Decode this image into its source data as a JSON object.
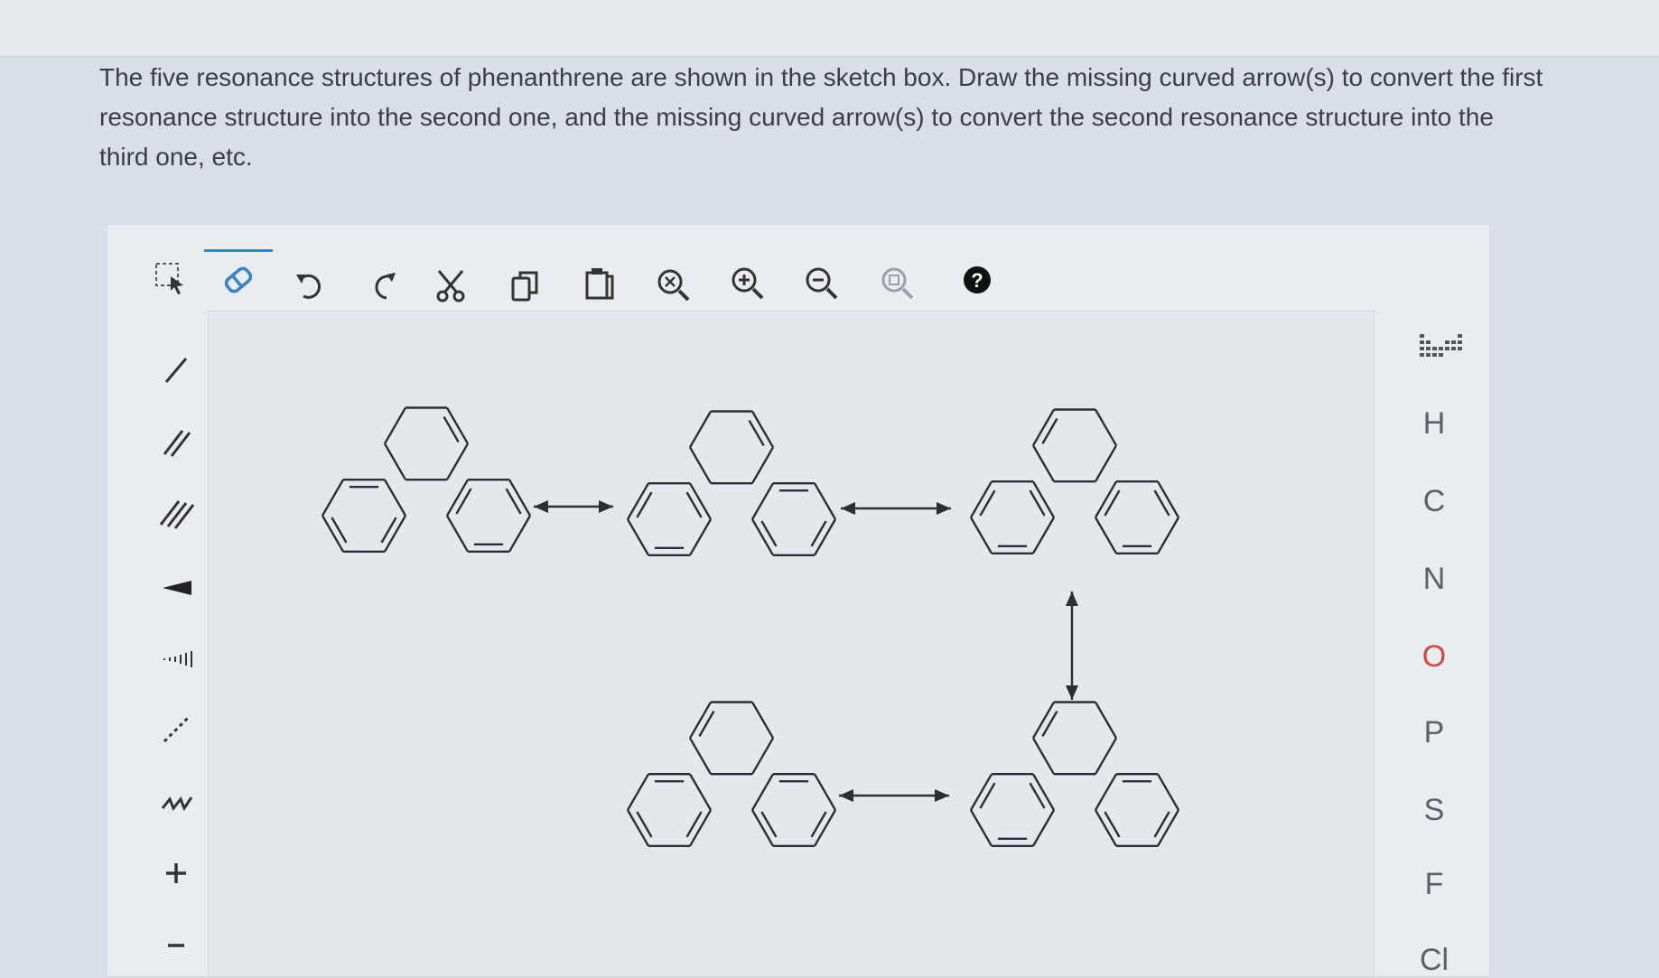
{
  "question": {
    "lines": [
      "The five resonance structures of phenanthrene are shown in the sketch box. Draw the missing curved arrow(s) to convert the first",
      "resonance structure into the second one, and the missing curved arrow(s) to convert the second resonance structure into the",
      "third one, etc."
    ]
  },
  "toolbar": {
    "tools": [
      "selection-tool",
      "eraser-tool",
      "undo",
      "redo",
      "cut",
      "copy",
      "paste",
      "zoom-fit",
      "zoom-in",
      "zoom-out",
      "zoom-reset",
      "help"
    ],
    "active": "eraser-tool"
  },
  "left_tools": [
    "single-bond",
    "double-bond",
    "triple-bond",
    "wedge-bond",
    "hash-bond",
    "dashed-bond",
    "chain-tool",
    "charge-plus",
    "charge-minus"
  ],
  "elements": [
    "H",
    "C",
    "N",
    "O",
    "P",
    "S",
    "F",
    "Cl"
  ],
  "colors": {
    "accent": "#3a82c4",
    "oxygen": "#d24a3c",
    "bond": "#2b2f33"
  }
}
